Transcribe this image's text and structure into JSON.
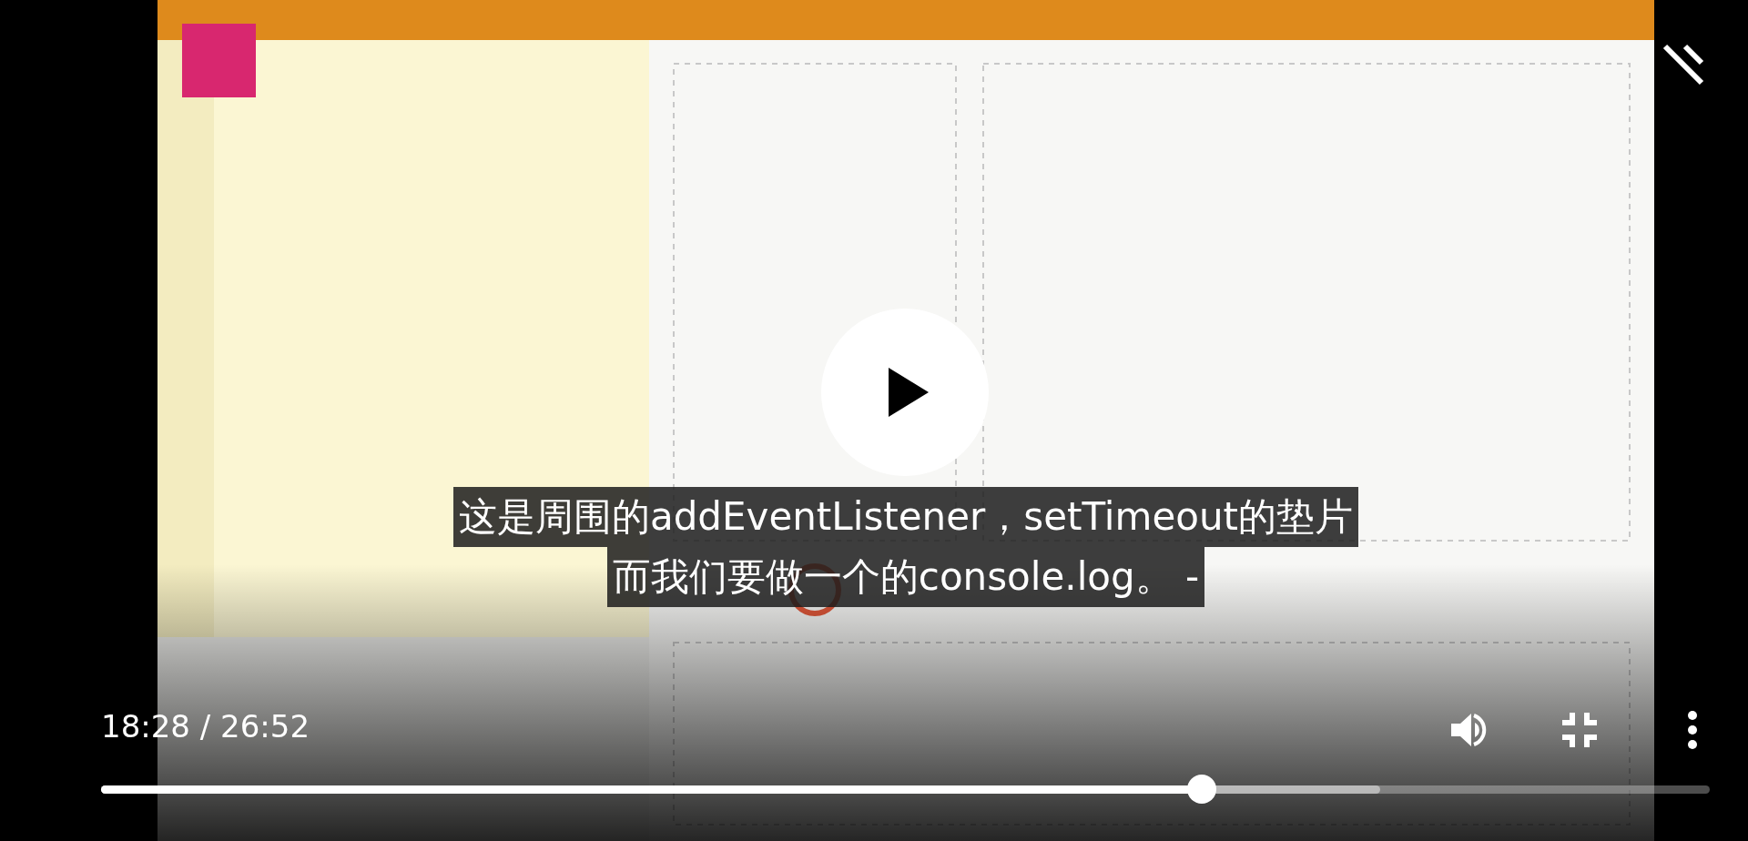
{
  "subtitles": [
    "这是周围的addEventListener，setTimeout的垫片",
    "而我们要做一个的console.log。 -"
  ],
  "time_display": "18:28 / 26:52",
  "progress": {
    "level": 0.684
  },
  "buffered": {
    "level": 0.795
  }
}
